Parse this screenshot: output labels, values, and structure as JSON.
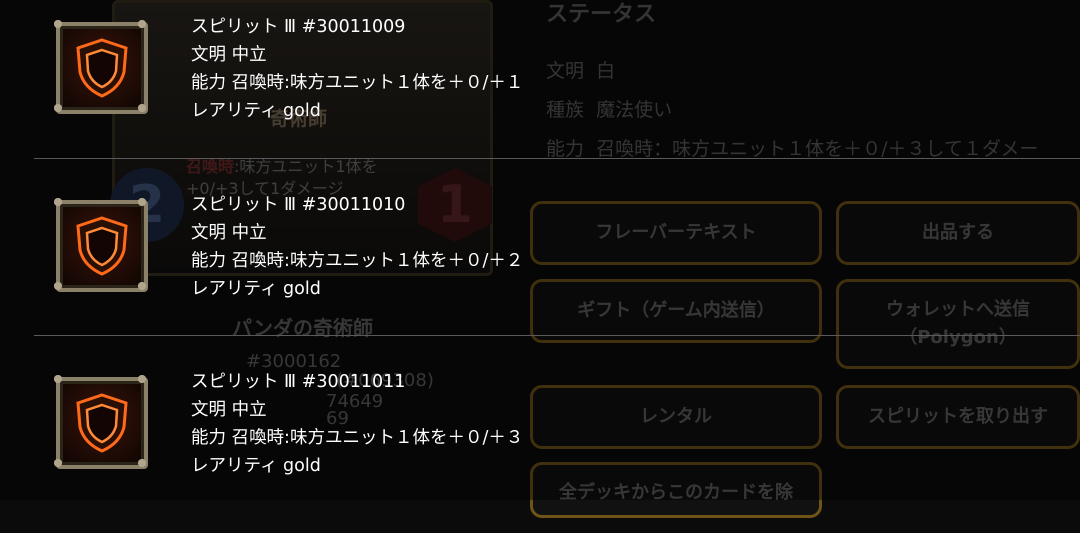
{
  "background": {
    "card": {
      "name_partial": "奇術師",
      "effect_tag": "召喚時",
      "effect_line1": ":味方ユニット1体を",
      "effect_line2": "+0/+3して1ダメージ",
      "cost": "2",
      "power": "1"
    },
    "info": {
      "name": "パンダの奇術師",
      "id_partial": "#3000162",
      "owner_partial": "(#069308)",
      "num_a": "74649",
      "num_b": "69"
    },
    "status": {
      "title": "ステータス",
      "civilization_label": "文明",
      "civilization_value": "白",
      "race_label": "種族",
      "race_value": "魔法使い",
      "ability_label": "能力",
      "ability_value": "召喚時：味方ユニット１体を＋０/＋３して１ダメー"
    },
    "buttons": {
      "flavor": "フレーバーテキスト",
      "list": "出品する",
      "gift": "ギフト（ゲーム内送信）",
      "wallet": "ウォレットへ送信\n（Polygon）",
      "rental": "レンタル",
      "take_spirit": "スピリットを取り出す",
      "remove_from_decks": "全デッキからこのカードを除"
    }
  },
  "spirits": [
    {
      "title": "スピリット Ⅲ #30011009",
      "civilization": "文明 中立",
      "ability": "能力 召喚時:味方ユニット１体を＋０/＋１",
      "rarity": "レアリティ gold"
    },
    {
      "title": "スピリット Ⅲ #30011010",
      "civilization": "文明 中立",
      "ability": "能力 召喚時:味方ユニット１体を＋０/＋２",
      "rarity": "レアリティ gold"
    },
    {
      "title": "スピリット Ⅲ #30011011",
      "civilization": "文明 中立",
      "ability": "能力 召喚時:味方ユニット１体を＋０/＋３",
      "rarity": "レアリティ gold"
    }
  ],
  "colors": {
    "shield_orange": "#ff6a1a",
    "frame": "#8b8068",
    "button_border": "#6f5417"
  }
}
